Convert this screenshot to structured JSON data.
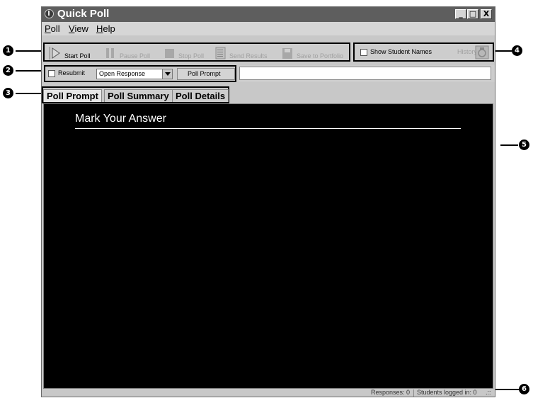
{
  "window": {
    "title": "Quick Poll",
    "controls": [
      "_",
      "□",
      "X"
    ]
  },
  "menu": [
    {
      "label": "Poll",
      "accel": "P",
      "rest": "oll"
    },
    {
      "label": "View",
      "accel": "V",
      "rest": "iew"
    },
    {
      "label": "Help",
      "accel": "H",
      "rest": "elp"
    }
  ],
  "toolbar": {
    "start_label": "Start Poll",
    "pause_label": "Pause Poll",
    "stop_label": "Stop Poll",
    "send_label": "Send Results",
    "save_label": "Save to Portfolio",
    "show_names_label": "Show Student Names",
    "history_label": "History"
  },
  "options": {
    "resubmit_label": "Resubmit",
    "response_type": "Open Response",
    "prompt_button": "Poll Prompt",
    "prompt_value": ""
  },
  "tabs": [
    "Poll Prompt",
    "Poll Summary",
    "Poll Details"
  ],
  "content": {
    "prompt_title": "Mark Your Answer"
  },
  "status": {
    "responses": "Responses: 0",
    "students": "Students logged in: 0",
    "grip": ".::"
  },
  "callouts": [
    "1",
    "2",
    "3",
    "4",
    "5",
    "6"
  ],
  "colors": {
    "titlebar": "#5e5e5e",
    "content_bg": "#000000",
    "chrome": "#c8c8c8"
  }
}
